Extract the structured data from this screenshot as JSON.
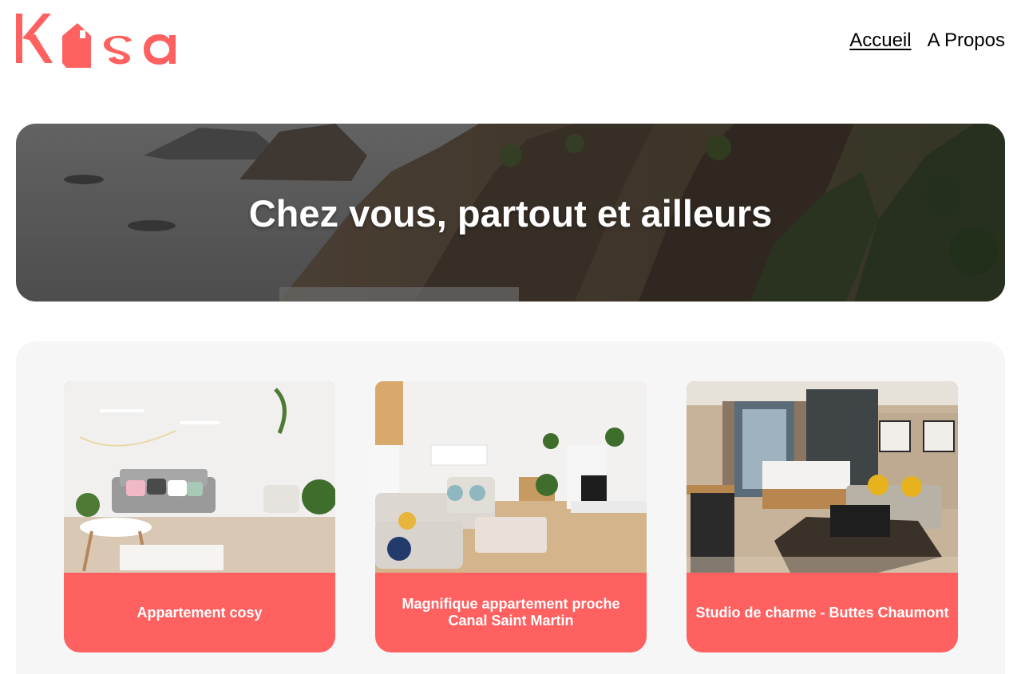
{
  "brand": {
    "logo_text": "Kasa",
    "color": "#ff6060"
  },
  "nav": {
    "items": [
      {
        "label": "Accueil",
        "active": true
      },
      {
        "label": "A Propos",
        "active": false
      }
    ]
  },
  "banner": {
    "title": "Chez vous, partout et ailleurs"
  },
  "listings": [
    {
      "title": "Appartement cosy"
    },
    {
      "title": "Magnifique appartement proche Canal Saint Martin"
    },
    {
      "title": "Studio de charme - Buttes Chaumont"
    }
  ]
}
